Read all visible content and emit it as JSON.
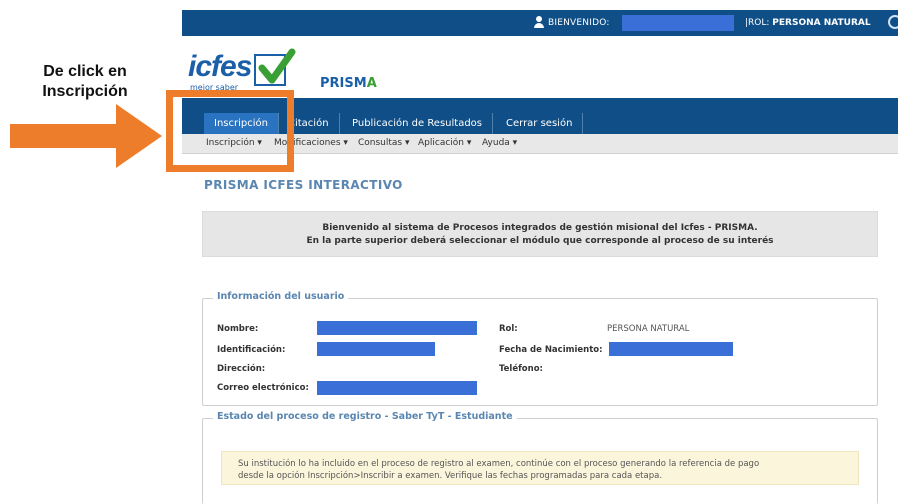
{
  "annotation": {
    "callout_line1": "De click en",
    "callout_line2": "Inscripción",
    "arrow_color": "#ee7d2b"
  },
  "topbar": {
    "welcome": "BIENVENIDO:",
    "role_label": "|ROL:",
    "role_value": "PERSONA NATURAL",
    "user_icon": "user-icon",
    "logout_icon": "power-icon"
  },
  "logo": {
    "word": "icfes",
    "tagline": "mejor saber",
    "app_name_part": "PRISM",
    "app_name_end": "A"
  },
  "nav": {
    "tabs": [
      "Inscripción",
      "Citación",
      "Publicación de Resultados",
      "Cerrar sesión"
    ],
    "active_tab": "Inscripción"
  },
  "subnav": [
    "Inscripción ▾",
    "Modificaciones ▾",
    "Consultas ▾",
    "Aplicación ▾",
    "Ayuda ▾"
  ],
  "page_title": "PRISMA ICFES INTERACTIVO",
  "welcome_box": {
    "line1": "Bienvenido al sistema de Procesos integrados de gestión misional del Icfes - PRISMA.",
    "line2": "En la parte superior deberá seleccionar el módulo que corresponde al proceso de su interés"
  },
  "user_info": {
    "legend": "Información del usuario",
    "nombre_label": "Nombre:",
    "identificacion_label": "Identificación:",
    "direccion_label": "Dirección:",
    "correo_label": "Correo electrónico:",
    "rol_label": "Rol:",
    "rol_value": "PERSONA NATURAL",
    "nacimiento_label": "Fecha de Nacimiento:",
    "telefono_label": "Teléfono:"
  },
  "registro": {
    "legend": "Estado del proceso de registro - Saber TyT - Estudiante",
    "notice_line1": "Su institución lo ha incluido en el proceso de registro al examen, continúe con el proceso generando la referencia de pago",
    "notice_line2": "desde la opción Inscripción>Inscribir a examen. Verifique las fechas programadas para cada etapa."
  },
  "colors": {
    "brand_blue": "#0f4e86",
    "active_tab": "#2a73c0",
    "redaction": "#3b6fd8",
    "title_blue": "#5a86b0"
  }
}
